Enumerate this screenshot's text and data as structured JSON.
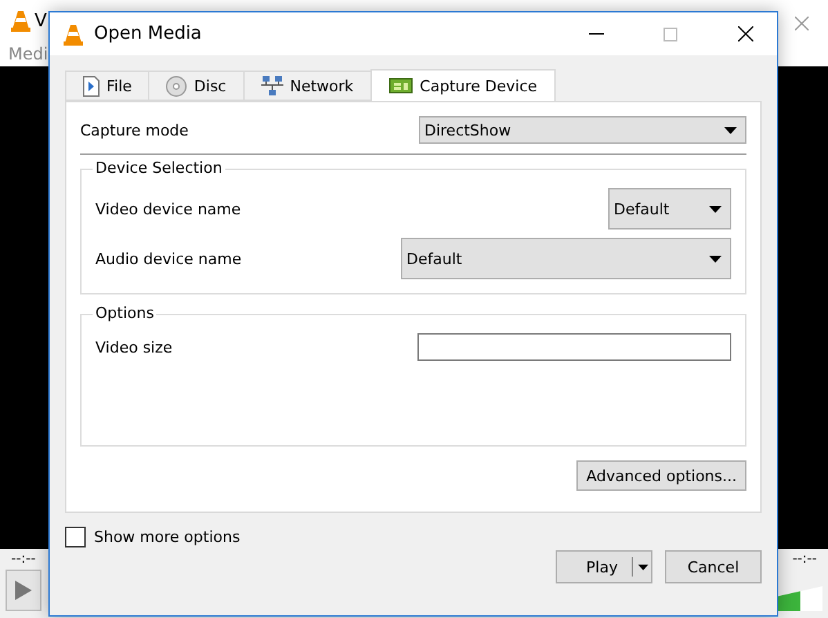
{
  "background_window": {
    "title": "V",
    "menu": [
      "Medi"
    ],
    "elapsed": "--:--",
    "total": "--:--",
    "volume": {
      "level": 0.8
    }
  },
  "dialog": {
    "title": "Open Media",
    "tabs": [
      {
        "label": "File",
        "selected": false
      },
      {
        "label": "Disc",
        "selected": false
      },
      {
        "label": "Network",
        "selected": false
      },
      {
        "label": "Capture Device",
        "selected": true
      }
    ],
    "capture_mode": {
      "label": "Capture mode",
      "value": "DirectShow"
    },
    "device_selection": {
      "title": "Device Selection",
      "video_device": {
        "label": "Video device name",
        "value": "Default"
      },
      "audio_device": {
        "label": "Audio device name",
        "value": "Default"
      }
    },
    "options": {
      "title": "Options",
      "video_size": {
        "label": "Video size"
      }
    },
    "advanced_button": "Advanced options...",
    "show_more_options": {
      "label": "Show more options",
      "checked": false
    },
    "buttons": {
      "play": "Play",
      "cancel": "Cancel"
    }
  }
}
